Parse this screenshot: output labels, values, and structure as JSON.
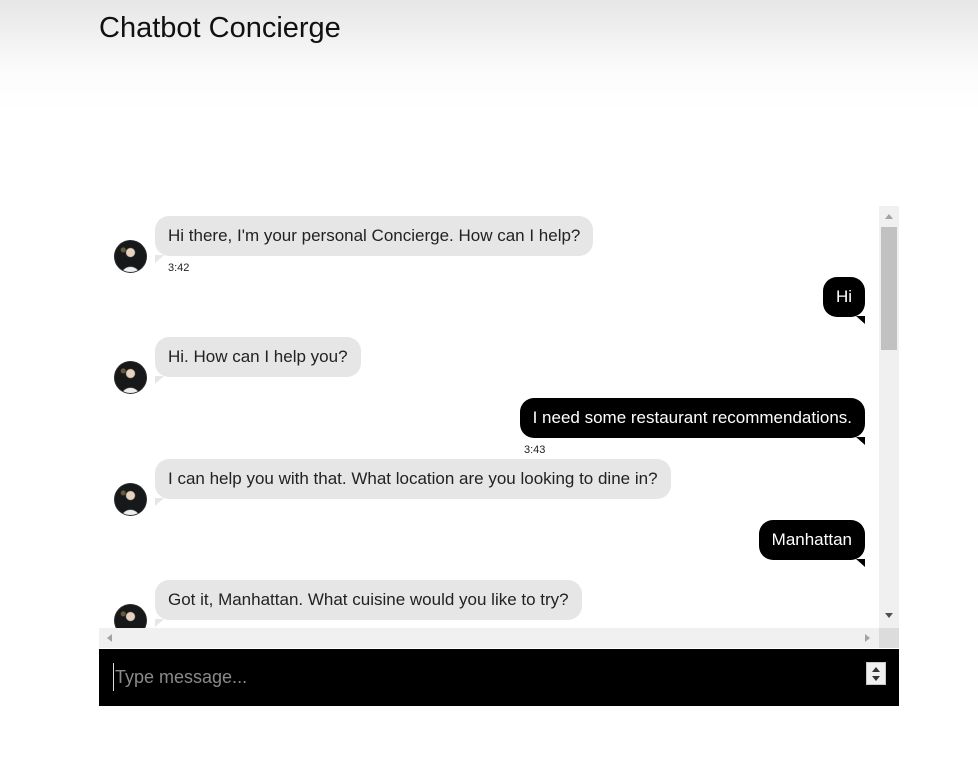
{
  "app": {
    "title": "Chatbot Concierge"
  },
  "messages": [
    {
      "sender": "bot",
      "text": "Hi there, I'm your personal Concierge. How can I help?",
      "time": "3:42"
    },
    {
      "sender": "user",
      "text": "Hi",
      "time": ""
    },
    {
      "sender": "bot",
      "text": "Hi. How can I help you?",
      "time": ""
    },
    {
      "sender": "user",
      "text": "I need some restaurant recommendations.",
      "time": "3:43"
    },
    {
      "sender": "bot",
      "text": "I can help you with that. What location are you looking to dine in?",
      "time": ""
    },
    {
      "sender": "user",
      "text": "Manhattan",
      "time": ""
    },
    {
      "sender": "bot",
      "text": "Got it, Manhattan. What cuisine would you like to try?",
      "time": ""
    }
  ],
  "composer": {
    "placeholder": "Type message..."
  },
  "colors": {
    "user_bubble": "#000000",
    "bot_bubble": "#e6e6e6",
    "composer_bg": "#000000"
  },
  "icons": {
    "avatar": "bot-avatar",
    "scroll_up": "scroll-up-arrow",
    "scroll_down": "scroll-down-arrow"
  }
}
